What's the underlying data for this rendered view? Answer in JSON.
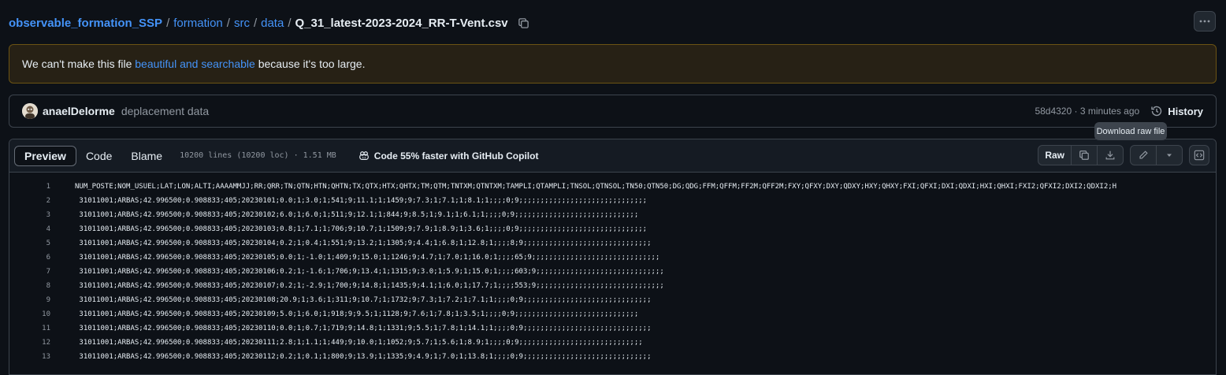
{
  "breadcrumb": {
    "repo": "observable_formation_SSP",
    "parts": [
      "formation",
      "src",
      "data"
    ],
    "file": "Q_31_latest-2023-2024_RR-T-Vent.csv"
  },
  "warning": {
    "before": "We can't make this file ",
    "link": "beautiful and searchable",
    "after": " because it's too large."
  },
  "commit": {
    "author": "anaelDelorme",
    "message": "deplacement data",
    "meta": "58d4320 · 3 minutes ago",
    "history_label": "History"
  },
  "tooltip": "Download raw file",
  "file_header": {
    "tabs": [
      "Preview",
      "Code",
      "Blame"
    ],
    "stats": "10200 lines (10200 loc) · 1.51 MB",
    "copilot": "Code 55% faster with GitHub Copilot",
    "raw_label": "Raw"
  },
  "lines": [
    {
      "n": "1",
      "text": "NUM_POSTE;NOM_USUEL;LAT;LON;ALTI;AAAAMMJJ;RR;QRR;TN;QTN;HTN;QHTN;TX;QTX;HTX;QHTX;TM;QTM;TNTXM;QTNTXM;TAMPLI;QTAMPLI;TNSOL;QTNSOL;TN50;QTN50;DG;QDG;FFM;QFFM;FF2M;QFF2M;FXY;QFXY;DXY;QDXY;HXY;QHXY;FXI;QFXI;DXI;QDXI;HXI;QHXI;FXI2;QFXI2;DXI2;QDXI2;H"
    },
    {
      "n": "2",
      "text": " 31011001;ARBAS;42.996500;0.908833;405;20230101;0.0;1;3.0;1;541;9;11.1;1;1459;9;7.3;1;7.1;1;8.1;1;;;;0;9;;;;;;;;;;;;;;;;;;;;;;;;;;;;;;"
    },
    {
      "n": "3",
      "text": " 31011001;ARBAS;42.996500;0.908833;405;20230102;6.0;1;6.0;1;511;9;12.1;1;844;9;8.5;1;9.1;1;6.1;1;;;;0;9;;;;;;;;;;;;;;;;;;;;;;;;;;;;;"
    },
    {
      "n": "4",
      "text": " 31011001;ARBAS;42.996500;0.908833;405;20230103;0.8;1;7.1;1;706;9;10.7;1;1509;9;7.9;1;8.9;1;3.6;1;;;;0;9;;;;;;;;;;;;;;;;;;;;;;;;;;;;;;"
    },
    {
      "n": "5",
      "text": " 31011001;ARBAS;42.996500;0.908833;405;20230104;0.2;1;0.4;1;551;9;13.2;1;1305;9;4.4;1;6.8;1;12.8;1;;;;8;9;;;;;;;;;;;;;;;;;;;;;;;;;;;;;;"
    },
    {
      "n": "6",
      "text": " 31011001;ARBAS;42.996500;0.908833;405;20230105;0.0;1;-1.0;1;409;9;15.0;1;1246;9;4.7;1;7.0;1;16.0;1;;;;65;9;;;;;;;;;;;;;;;;;;;;;;;;;;;;;;"
    },
    {
      "n": "7",
      "text": " 31011001;ARBAS;42.996500;0.908833;405;20230106;0.2;1;-1.6;1;706;9;13.4;1;1315;9;3.0;1;5.9;1;15.0;1;;;;603;9;;;;;;;;;;;;;;;;;;;;;;;;;;;;;;"
    },
    {
      "n": "8",
      "text": " 31011001;ARBAS;42.996500;0.908833;405;20230107;0.2;1;-2.9;1;700;9;14.8;1;1435;9;4.1;1;6.0;1;17.7;1;;;;553;9;;;;;;;;;;;;;;;;;;;;;;;;;;;;;;"
    },
    {
      "n": "9",
      "text": " 31011001;ARBAS;42.996500;0.908833;405;20230108;20.9;1;3.6;1;311;9;10.7;1;1732;9;7.3;1;7.2;1;7.1;1;;;;0;9;;;;;;;;;;;;;;;;;;;;;;;;;;;;;;"
    },
    {
      "n": "10",
      "text": " 31011001;ARBAS;42.996500;0.908833;405;20230109;5.0;1;6.0;1;918;9;9.5;1;1128;9;7.6;1;7.8;1;3.5;1;;;;0;9;;;;;;;;;;;;;;;;;;;;;;;;;;;;;"
    },
    {
      "n": "11",
      "text": " 31011001;ARBAS;42.996500;0.908833;405;20230110;0.0;1;0.7;1;719;9;14.8;1;1331;9;5.5;1;7.8;1;14.1;1;;;;0;9;;;;;;;;;;;;;;;;;;;;;;;;;;;;;;"
    },
    {
      "n": "12",
      "text": " 31011001;ARBAS;42.996500;0.908833;405;20230111;2.8;1;1.1;1;449;9;10.0;1;1052;9;5.7;1;5.6;1;8.9;1;;;;0;9;;;;;;;;;;;;;;;;;;;;;;;;;;;;;"
    },
    {
      "n": "13",
      "text": " 31011001;ARBAS;42.996500;0.908833;405;20230112;0.2;1;0.1;1;800;9;13.9;1;1335;9;4.9;1;7.0;1;13.8;1;;;;0;9;;;;;;;;;;;;;;;;;;;;;;;;;;;;;;"
    }
  ]
}
